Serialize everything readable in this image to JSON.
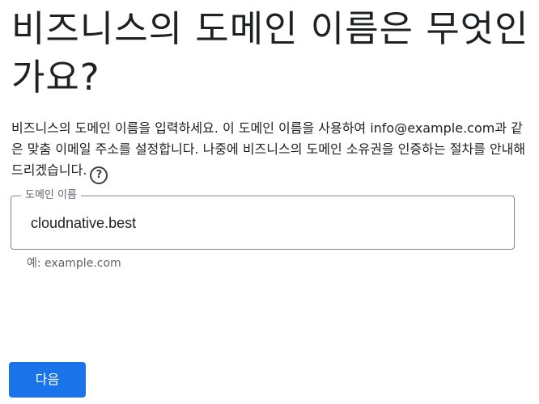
{
  "page": {
    "title": "비즈니스의 도메인 이름은 무엇인가요?",
    "description": "비즈니스의 도메인 이름을 입력하세요. 이 도메인 이름을 사용하여 info@example.com과 같은 맞춤 이메일 주소를 설정합니다. 나중에 비즈니스의 도메인 소유권을 인증하는 절차를 안내해 드리겠습니다.",
    "help_icon_glyph": "?"
  },
  "domain_field": {
    "label": "도메인 이름",
    "value": "cloudnative.best",
    "hint": "예: example.com"
  },
  "actions": {
    "next_label": "다음"
  },
  "colors": {
    "primary": "#1a73e8",
    "text": "#202124",
    "secondary_text": "#5f6368",
    "border": "#80868b"
  },
  "icons": {
    "help": "help-circle-icon"
  }
}
